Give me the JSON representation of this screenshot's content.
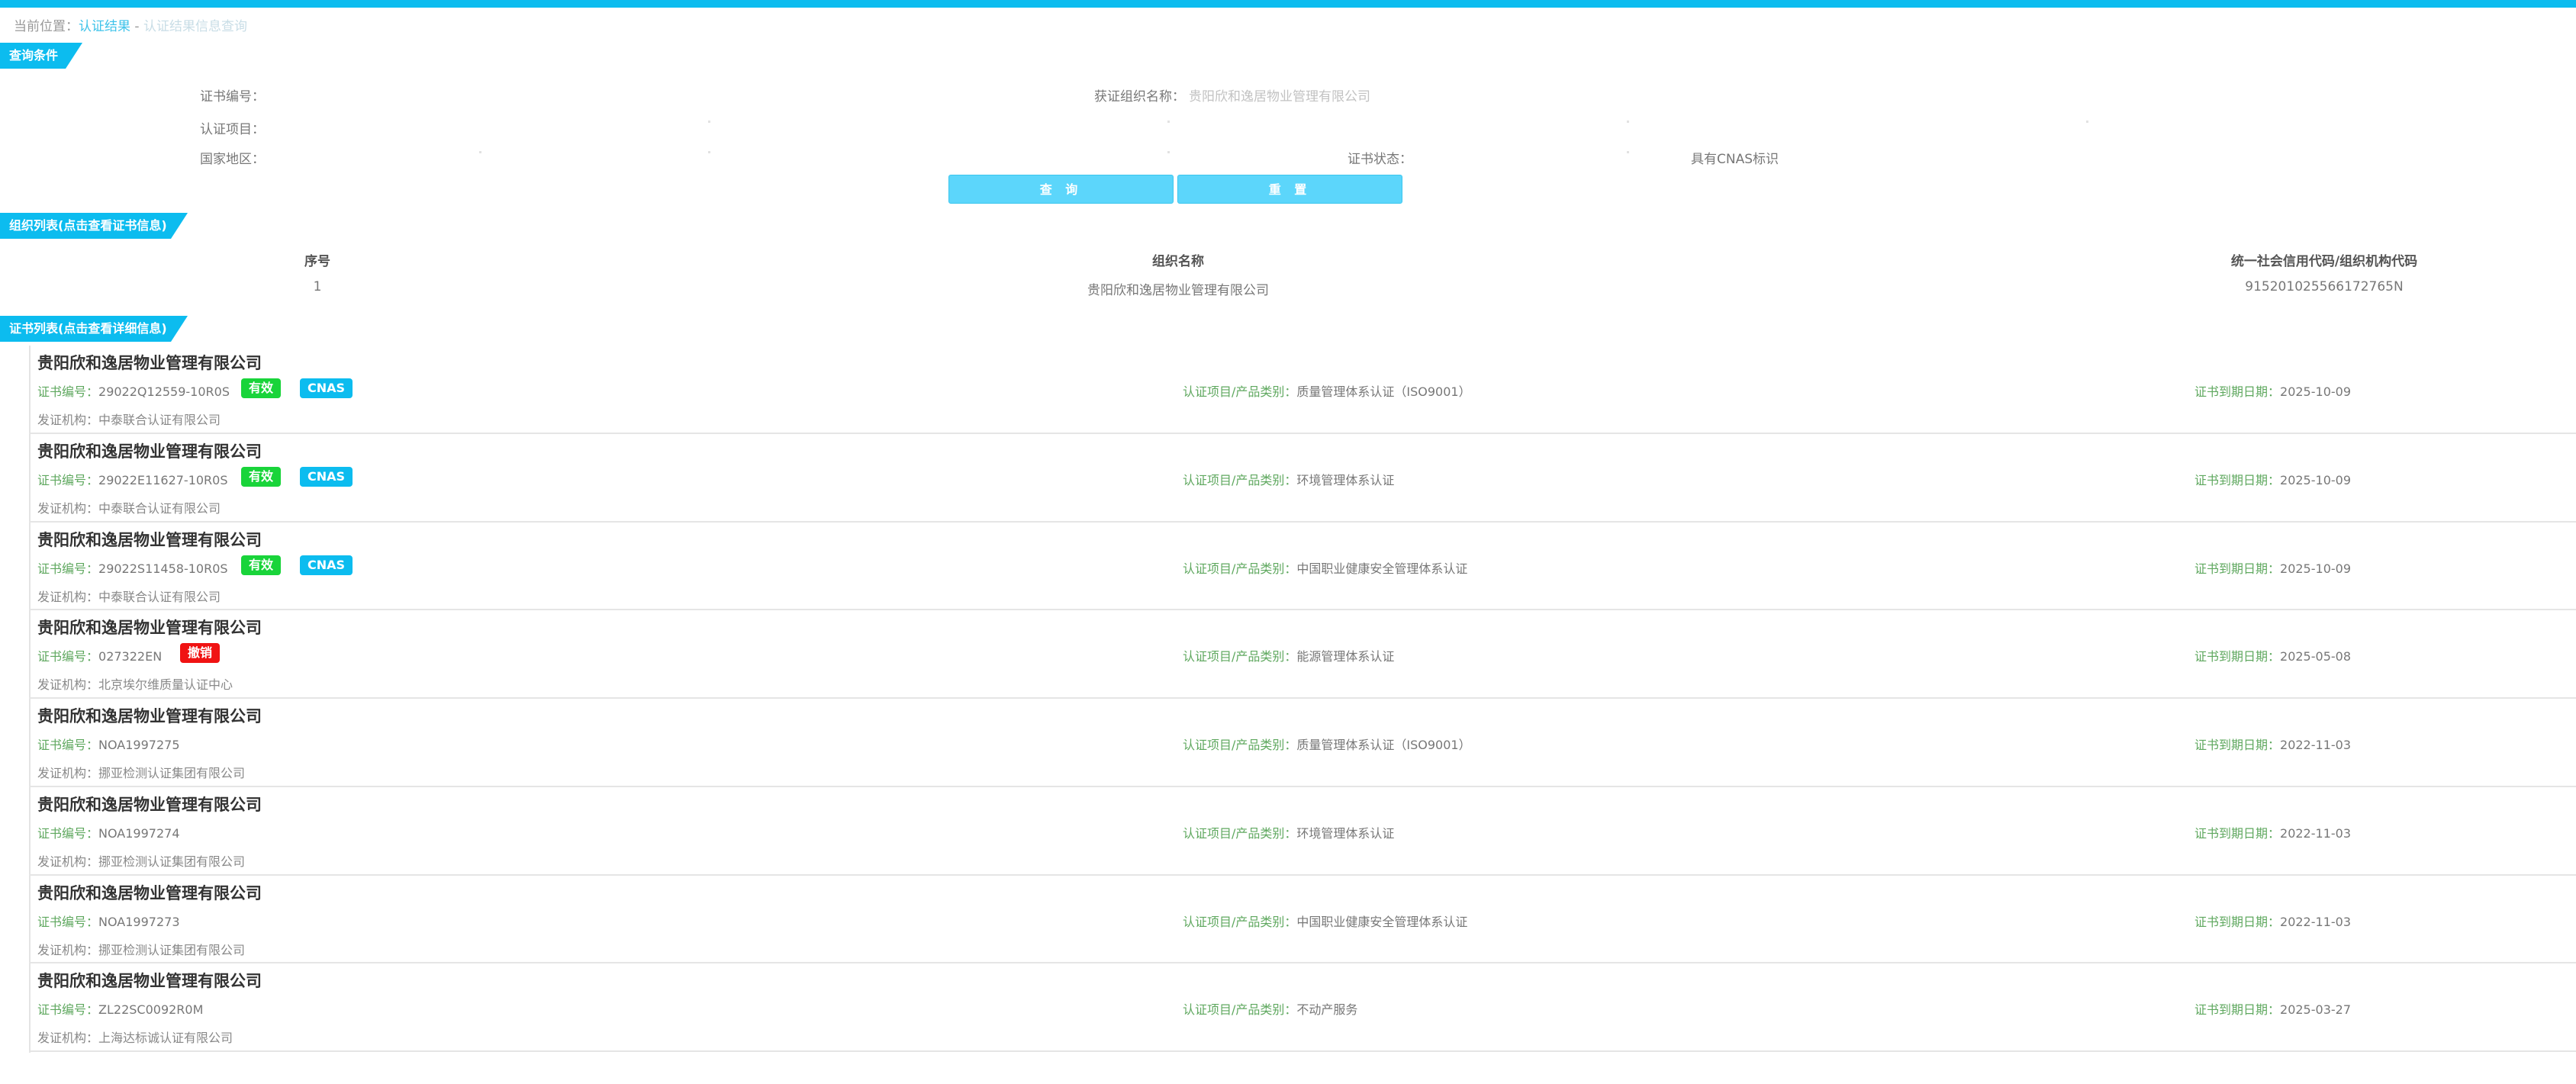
{
  "breadcrumb": {
    "prefix": "当前位置：",
    "link": "认证结果",
    "separator": " - ",
    "current": "认证结果信息查询"
  },
  "query": {
    "title": "查询条件",
    "cert_no_label": "证书编号：",
    "org_name_label": "获证组织名称：",
    "org_name_value": "贵阳欣和逸居物业管理有限公司",
    "project_label": "认证项目：",
    "region_label": "国家地区：",
    "status_label": "证书状态：",
    "cnas_label": "具有CNAS标识",
    "search_button": "查 询",
    "reset_button": "重 置"
  },
  "org_list": {
    "title": "组织列表(点击查看证书信息)",
    "headers": [
      "序号",
      "组织名称",
      "统一社会信用代码/组织机构代码"
    ],
    "rows": [
      [
        "1",
        "贵阳欣和逸居物业管理有限公司",
        "915201025566172765N"
      ]
    ]
  },
  "cert_list": {
    "title": "证书列表(点击查看详细信息)",
    "cert_no_label": "证书编号：",
    "project_label": "认证项目/产品类别：",
    "expiry_label": "证书到期日期：",
    "issuer_label": "发证机构：",
    "items": [
      {
        "org": "贵阳欣和逸居物业管理有限公司",
        "cert_no": "29022Q12559-10R0S",
        "status": "有效",
        "cnas": "CNAS",
        "project": "质量管理体系认证（ISO9001）",
        "expiry": "2025-10-09",
        "issuer": "中泰联合认证有限公司"
      },
      {
        "org": "贵阳欣和逸居物业管理有限公司",
        "cert_no": "29022E11627-10R0S",
        "status": "有效",
        "cnas": "CNAS",
        "project": "环境管理体系认证",
        "expiry": "2025-10-09",
        "issuer": "中泰联合认证有限公司"
      },
      {
        "org": "贵阳欣和逸居物业管理有限公司",
        "cert_no": "29022S11458-10R0S",
        "status": "有效",
        "cnas": "CNAS",
        "project": "中国职业健康安全管理体系认证",
        "expiry": "2025-10-09",
        "issuer": "中泰联合认证有限公司"
      },
      {
        "org": "贵阳欣和逸居物业管理有限公司",
        "cert_no": "027322EN",
        "status": "撤销",
        "cnas": "",
        "project": "能源管理体系认证",
        "expiry": "2025-05-08",
        "issuer": "北京埃尔维质量认证中心"
      },
      {
        "org": "贵阳欣和逸居物业管理有限公司",
        "cert_no": "NOA1997275",
        "status": "",
        "cnas": "",
        "project": "质量管理体系认证（ISO9001）",
        "expiry": "2022-11-03",
        "issuer": "挪亚检测认证集团有限公司"
      },
      {
        "org": "贵阳欣和逸居物业管理有限公司",
        "cert_no": "NOA1997274",
        "status": "",
        "cnas": "",
        "project": "环境管理体系认证",
        "expiry": "2022-11-03",
        "issuer": "挪亚检测认证集团有限公司"
      },
      {
        "org": "贵阳欣和逸居物业管理有限公司",
        "cert_no": "NOA1997273",
        "status": "",
        "cnas": "",
        "project": "中国职业健康安全管理体系认证",
        "expiry": "2022-11-03",
        "issuer": "挪亚检测认证集团有限公司"
      },
      {
        "org": "贵阳欣和逸居物业管理有限公司",
        "cert_no": "ZL22SC0092R0M",
        "status": "",
        "cnas": "",
        "project": "不动产服务",
        "expiry": "2025-03-27",
        "issuer": "上海达标诚认证有限公司"
      }
    ]
  },
  "colors": {
    "accent": "#0cbcef",
    "valid": "#19d43a",
    "revoked": "#f01313",
    "button": "#5cd6fb"
  }
}
